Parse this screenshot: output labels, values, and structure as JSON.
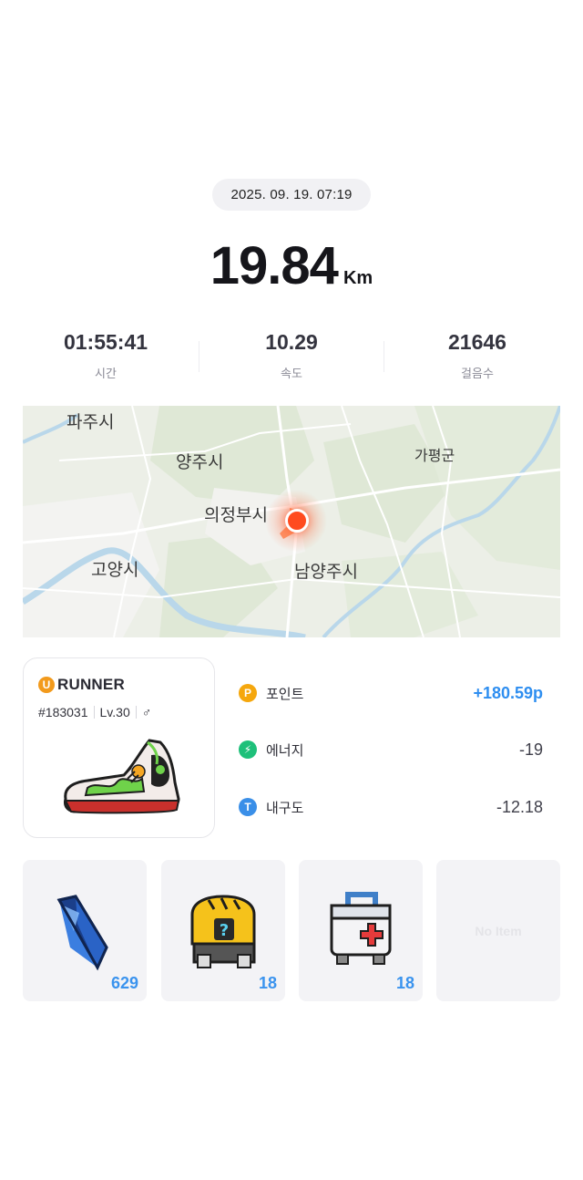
{
  "record": {
    "datetime": "2025. 09. 19. 07:19",
    "distance": "19.84",
    "distance_unit": "Km"
  },
  "stats": [
    {
      "value": "01:55:41",
      "label": "시간"
    },
    {
      "value": "10.29",
      "label": "속도"
    },
    {
      "value": "21646",
      "label": "걸음수"
    }
  ],
  "map": {
    "labels": [
      "파주시",
      "양주시",
      "가평군",
      "의정부시",
      "고양시",
      "남양주시"
    ],
    "marker_icon": "location-pin-icon"
  },
  "runner": {
    "badge": "U",
    "name": "RUNNER",
    "id": "#183031",
    "level": "Lv.30",
    "gender_icon": "male-symbol",
    "gender_glyph": "♂"
  },
  "rewards": [
    {
      "icon": "P",
      "label": "포인트",
      "value": "+180.59p"
    },
    {
      "icon": "⚡",
      "label": "에너지",
      "value": "-19"
    },
    {
      "icon": "T",
      "label": "내구도",
      "value": "-12.18"
    }
  ],
  "items": [
    {
      "name": "blue-gem",
      "count": "629"
    },
    {
      "name": "mystery-box",
      "count": "18"
    },
    {
      "name": "repair-kit",
      "count": "18"
    },
    {
      "empty_label": "No Item"
    }
  ],
  "colors": {
    "accent_blue": "#2e8ef0",
    "point_orange": "#f5a70d",
    "energy_green": "#1ec07a",
    "durability_blue": "#3a8fe8",
    "marker_red": "#ff4b1f"
  }
}
